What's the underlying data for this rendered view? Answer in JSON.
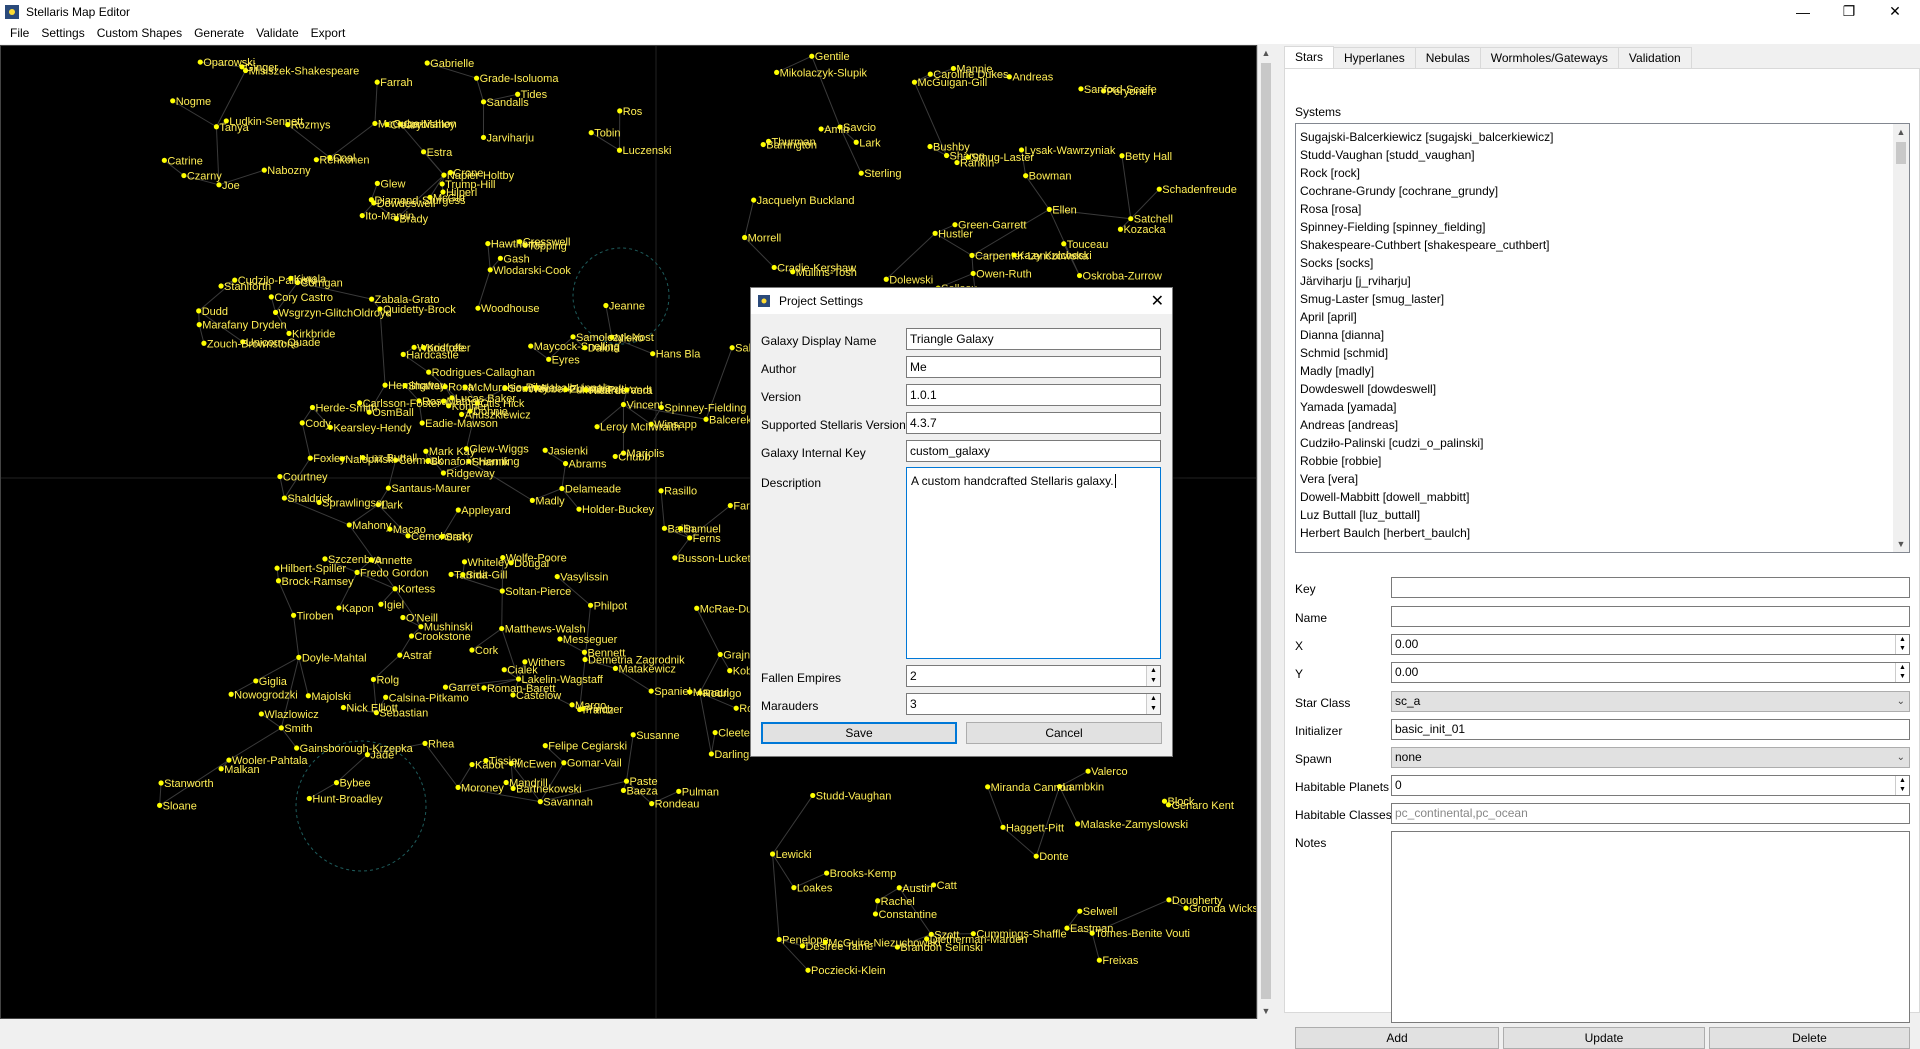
{
  "window": {
    "title": "Stellaris Map Editor",
    "minimize_glyph": "—",
    "maximize_glyph": "❐",
    "close_glyph": "✕"
  },
  "menu": [
    "File",
    "Settings",
    "Custom Shapes",
    "Generate",
    "Validate",
    "Export"
  ],
  "colors": {
    "star": "#ffff00",
    "label": "#ffee55",
    "lane": "#3a3a3a",
    "accent": "#0078d7"
  },
  "map": {
    "labels": [
      "Brady",
      "Tanya",
      "Dowdeswell",
      "Dudd",
      "Napier-Holtby",
      "Corrigan",
      "Grade-Isoluoma",
      "Corbishley",
      "Sandalls",
      "McGirr",
      "Misiszek-Shakespeare",
      "Misko",
      "Joe",
      "Ros",
      "Ito-Marvin",
      "Jarviharju",
      "Unicorn-Quade",
      "McGuire-Mahon",
      "Estra",
      "Cudzilo-Palinski",
      "Coal",
      "Marafany Dryden",
      "Wsgrzyn-GlitchOldroyd",
      "Cleary",
      "Crone",
      "Topping",
      "Ludkin-Sennett",
      "Farrah",
      "Czarny",
      "Hawthorne",
      "Luczenski",
      "Diamond-Sturgess",
      "Zabala-Grato",
      "Glew",
      "Rozmys",
      "Tides",
      "Kiwala",
      "Samolczyk-Yost",
      "Jeanne",
      "Cresswell",
      "Gabrielle",
      "Rehkonen",
      "Nabozny",
      "Wlodarski-Cook",
      "Kirkbride",
      "Catrine",
      "Trump-Hill",
      "Zouch-Brownstone",
      "Quidetty-Brock",
      "Hilperl",
      "Staniforth",
      "Tobin",
      "Nogme",
      "Gash",
      "Woodhouse",
      "Cory Castro",
      "Ginger",
      "Oparowski",
      "Carpenter-Lenczowska",
      "Peryonen",
      "Mannie",
      "Sterling",
      "Thurman",
      "Savcio",
      "Sanford-Scaife",
      "Gentile",
      "Andreas",
      "McGuigan-Gill",
      "Sharon",
      "Morrell",
      "Hustler",
      "Dolewski",
      "Ellen",
      "Lark",
      "Cradie-Kershaw",
      "Mikolaczyk-Slupik",
      "Amin",
      "Jacquelyn Buckland",
      "Bushby",
      "Owen-Ruth",
      "Smug-Laster",
      "Mullins-Tosh",
      "Bowman",
      "Satchell",
      "Sellasu",
      "Betty Hall",
      "Green-Garrett",
      "Oskroba-Zurrow",
      "James Langston",
      "Kazy Kulcheski",
      "Caroline Dukes",
      "Schadenfreude",
      "Lysak-Wawrzyniak",
      "Touceau",
      "Rankin",
      "Kozacka",
      "Barrington",
      "Savannah",
      "Doyle-Mahtal",
      "Kortess",
      "Moroney",
      "Mahony",
      "Marjolis",
      "McEwen",
      "Smith",
      "Ferns",
      "Hemingway",
      "Sharnik",
      "Shaldrick",
      "Garret",
      "Wooler-Pahtala",
      "Glew-Wiggs",
      "Vincent",
      "Eyres",
      "Lark",
      "Fredo Gordon",
      "Darling",
      "Paste",
      "Shafter",
      "Lakelin-Wagstaff",
      "Ridgeway",
      "Balcerek-Kopiec",
      "Frantz",
      "Tiroben",
      "Bartnekowski",
      "Madly",
      "Otis Hick",
      "Roman-Barett",
      "Mushinski",
      "Donnie",
      "Rodrigo",
      "Rhea",
      "Jade",
      "Foxley",
      "Farnes",
      "Matthews-Walsh",
      "Szczenbva",
      "Santaus-Maurer",
      "Kapon",
      "Cork",
      "Maycock-Snelling",
      "Dalota",
      "Rosa",
      "Grajnert",
      "Cody",
      "Rondeau",
      "McRae-Dunning",
      "Delameade",
      "Crookstone",
      "Mandrill",
      "Demetria Zagrodnik",
      "Nalepinski",
      "Rodrigues-Callaghan",
      "Soltan-Pierce",
      "McMurchie-Pike",
      "OsmBall",
      "Lucas Baker",
      "Cemohorsky",
      "Wolfe-Poore",
      "Astraf",
      "Annette",
      "Abrams",
      "Busson-Luckett",
      "Tarrida",
      "Margo",
      "Giglia",
      "Nowogrodzki",
      "Courtney",
      "Rolg",
      "Smit-Gill",
      "Hans Bla",
      "Matakewicz",
      "Baeza",
      "Mark Kay",
      "Gomar-Vail",
      "Sarki",
      "Winsapp",
      "O'Neill",
      "Southey",
      "Alaball-Linnala",
      "Sakamoto-MacAuley",
      "Cormack",
      "Chubb",
      "Bailin",
      "Herde-Smith",
      "Felipe Cegiarski",
      "Hardcastle",
      "Sloane",
      "Jasienki",
      "Rosa",
      "Webber-Zdembinski",
      "Philpot",
      "Bybee",
      "Bennett",
      "Kohnen",
      "Castelow",
      "Pulman",
      "Leroy McIlwraith",
      "Sebastian",
      "Bonafont-Henning",
      "Stanworth",
      "Rasillo",
      "Majolski",
      "Cialek",
      "Igiel",
      "Spaniel",
      "Withers",
      "Rosenberg",
      "Whiteley",
      "Anuszkiewicz",
      "Luz Buttall",
      "Eadie-Mawson",
      "Sprawlingson",
      "Kearsley-Hendy",
      "PukowoPukrandt",
      "Brock-Ramsey",
      "Cleeter",
      "Vasylissin",
      "Kabot",
      "Hilbert-Spiller",
      "Messeguer",
      "Pincher",
      "Holder-Buckey",
      "Manaui",
      "Samuel",
      "Kobierzynski-Boguszewski",
      "Ricardo",
      "Hunt-Broadley",
      "Nick Elliott",
      "Malkan",
      "Wlazlowicz",
      "Susanne",
      "Dougal",
      "Vera",
      "Spinney-Fielding",
      "Woodfree",
      "Mather",
      "Tissier",
      "Calsina-Pitkamo",
      "Carlsson-Foster",
      "Macao",
      "Kristoffer",
      "Appleyard",
      "Gainsborough-Krzepka",
      "Pocziecki-Klein",
      "Penelope",
      "Lewicki",
      "Loakes",
      "Donte",
      "Block",
      "Brooks-Kemp",
      "Szott",
      "Tomes-Benite Vouti",
      "Lambkin",
      "Malaske-Zamyslowski",
      "Dougherty",
      "Gronda Wicks",
      "Genaro Kent",
      "Valerco",
      "Austin",
      "Brandon Selinski",
      "Haggett-Pitt",
      "Studd-Vaughan",
      "Rachel",
      "Eastman",
      "Selwell",
      "Desiree Tame",
      "Cummings-Shaffle",
      "Catt",
      "McGuire-Niezuchowski",
      "Constantine",
      "Miranda Cannon",
      "Freixas",
      "Dietherman-Marden"
    ]
  },
  "tabs": [
    "Stars",
    "Hyperlanes",
    "Nebulas",
    "Wormholes/Gateways",
    "Validation"
  ],
  "systems_label": "Systems",
  "systems": [
    "Sugajski-Balcerkiewicz [sugajski_balcerkiewicz]",
    "Studd-Vaughan [studd_vaughan]",
    "Rock [rock]",
    "Cochrane-Grundy [cochrane_grundy]",
    "Rosa [rosa]",
    "Spinney-Fielding [spinney_fielding]",
    "Shakespeare-Cuthbert [shakespeare_cuthbert]",
    "Socks [socks]",
    "Järviharju [j_rviharju]",
    "Smug-Laster [smug_laster]",
    "April [april]",
    "Dianna [dianna]",
    "Schmid [schmid]",
    "Madly [madly]",
    "Dowdeswell [dowdeswell]",
    "Yamada [yamada]",
    "Andreas [andreas]",
    "Cudziło-Palinski [cudzi_o_palinski]",
    "Robbie [robbie]",
    "Vera [vera]",
    "Dowell-Mabbitt [dowell_mabbitt]",
    "Luz Buttall [luz_buttall]",
    "Herbert Baulch [herbert_baulch]"
  ],
  "form": {
    "key_label": "Key",
    "key_value": "",
    "name_label": "Name",
    "name_value": "",
    "x_label": "X",
    "x_value": "0.00",
    "y_label": "Y",
    "y_value": "0.00",
    "star_class_label": "Star Class",
    "star_class_value": "sc_a",
    "initializer_label": "Initializer",
    "initializer_value": "basic_init_01",
    "spawn_label": "Spawn",
    "spawn_value": "none",
    "habitable_planets_label": "Habitable Planets",
    "habitable_planets_value": "0",
    "habitable_classes_label": "Habitable Classes",
    "habitable_classes_placeholder": "pc_continental,pc_ocean",
    "notes_label": "Notes"
  },
  "buttons": {
    "add": "Add",
    "update": "Update",
    "delete": "Delete"
  },
  "dialog": {
    "title": "Project Settings",
    "close_glyph": "✕",
    "galaxy_display_name_label": "Galaxy Display Name",
    "galaxy_display_name_value": "Triangle Galaxy",
    "author_label": "Author",
    "author_value": "Me",
    "version_label": "Version",
    "version_value": "1.0.1",
    "supported_version_label": "Supported Stellaris Version",
    "supported_version_value": "4.3.7",
    "internal_key_label": "Galaxy Internal Key",
    "internal_key_value": "custom_galaxy",
    "description_label": "Description",
    "description_value": "A custom handcrafted Stellaris galaxy.",
    "fallen_empires_label": "Fallen Empires",
    "fallen_empires_value": "2",
    "marauders_label": "Marauders",
    "marauders_value": "3",
    "save": "Save",
    "cancel": "Cancel"
  }
}
